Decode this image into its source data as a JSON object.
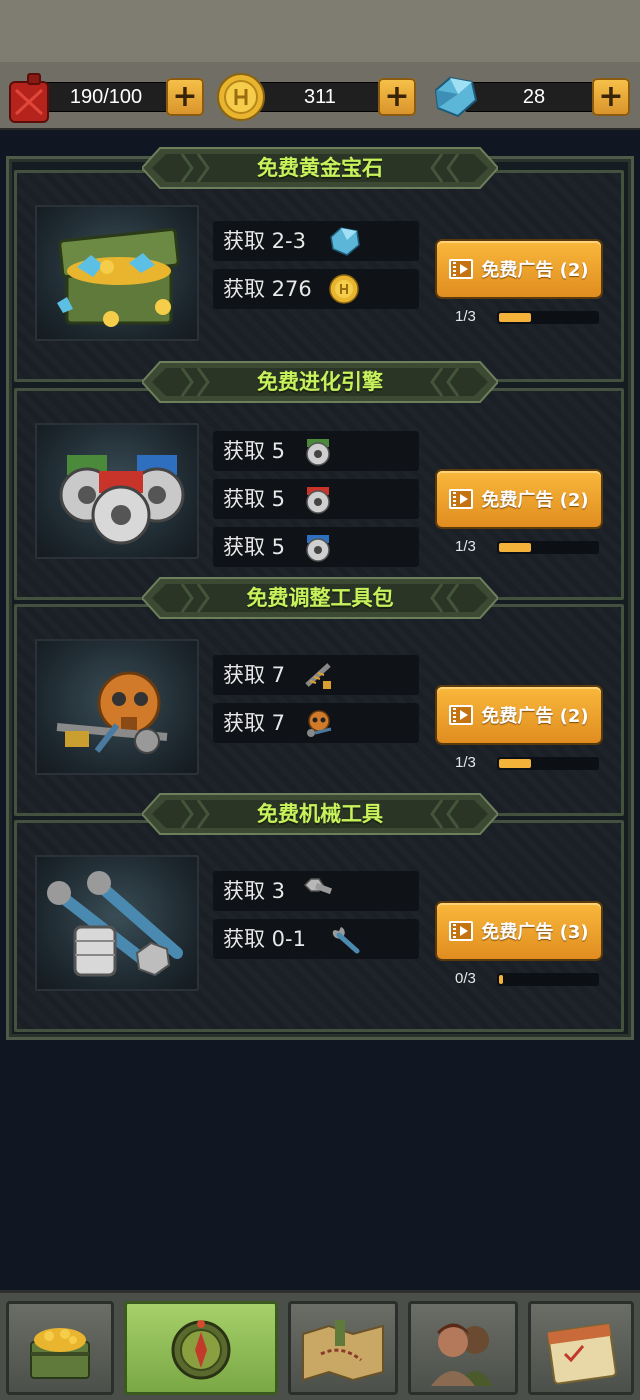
{
  "resources": {
    "fuel": {
      "value": "190/100",
      "icon": "fuel-can-icon"
    },
    "coins": {
      "value": "311",
      "icon": "gold-coin-icon"
    },
    "gems": {
      "value": "28",
      "icon": "blue-gem-icon"
    },
    "plus_label": "+"
  },
  "sections": [
    {
      "title": "免费黄金宝石",
      "thumb_icon": "treasure-chest-icon",
      "rewards": [
        {
          "label": "获取 2-3",
          "icon": "blue-gem-icon"
        },
        {
          "label": "获取 276",
          "icon": "gold-coin-icon"
        }
      ],
      "button_label": "免费广告 (2)",
      "progress_text": "1/3",
      "progress": 0.33
    },
    {
      "title": "免费进化引擎",
      "thumb_icon": "engines-icon",
      "rewards": [
        {
          "label": "获取 5",
          "icon": "green-engine-icon"
        },
        {
          "label": "获取 5",
          "icon": "red-engine-icon"
        },
        {
          "label": "获取 5",
          "icon": "blue-engine-icon"
        }
      ],
      "button_label": "免费广告 (2)",
      "progress_text": "1/3",
      "progress": 0.33
    },
    {
      "title": "免费调整工具包",
      "thumb_icon": "tool-kit-icon",
      "rewards": [
        {
          "label": "获取 7",
          "icon": "spring-icon"
        },
        {
          "label": "获取 7",
          "icon": "gas-mask-icon"
        }
      ],
      "button_label": "免费广告 (2)",
      "progress_text": "1/3",
      "progress": 0.33
    },
    {
      "title": "免费机械工具",
      "thumb_icon": "wrenches-icon",
      "rewards": [
        {
          "label": "获取 3",
          "icon": "bolt-icon"
        },
        {
          "label": "获取 0-1",
          "icon": "wrench-icon"
        }
      ],
      "button_label": "免费广告 (3)",
      "progress_text": "0/3",
      "progress": 0.0
    }
  ],
  "nav": [
    {
      "icon": "shop-chest-icon",
      "active": false
    },
    {
      "icon": "compass-icon",
      "active": true
    },
    {
      "icon": "map-icon",
      "active": false
    },
    {
      "icon": "survivors-icon",
      "active": false
    },
    {
      "icon": "calendar-icon",
      "active": false
    }
  ],
  "colors": {
    "accent": "#f3b33b",
    "title": "#c7f25c",
    "panel": "#1a2026"
  }
}
